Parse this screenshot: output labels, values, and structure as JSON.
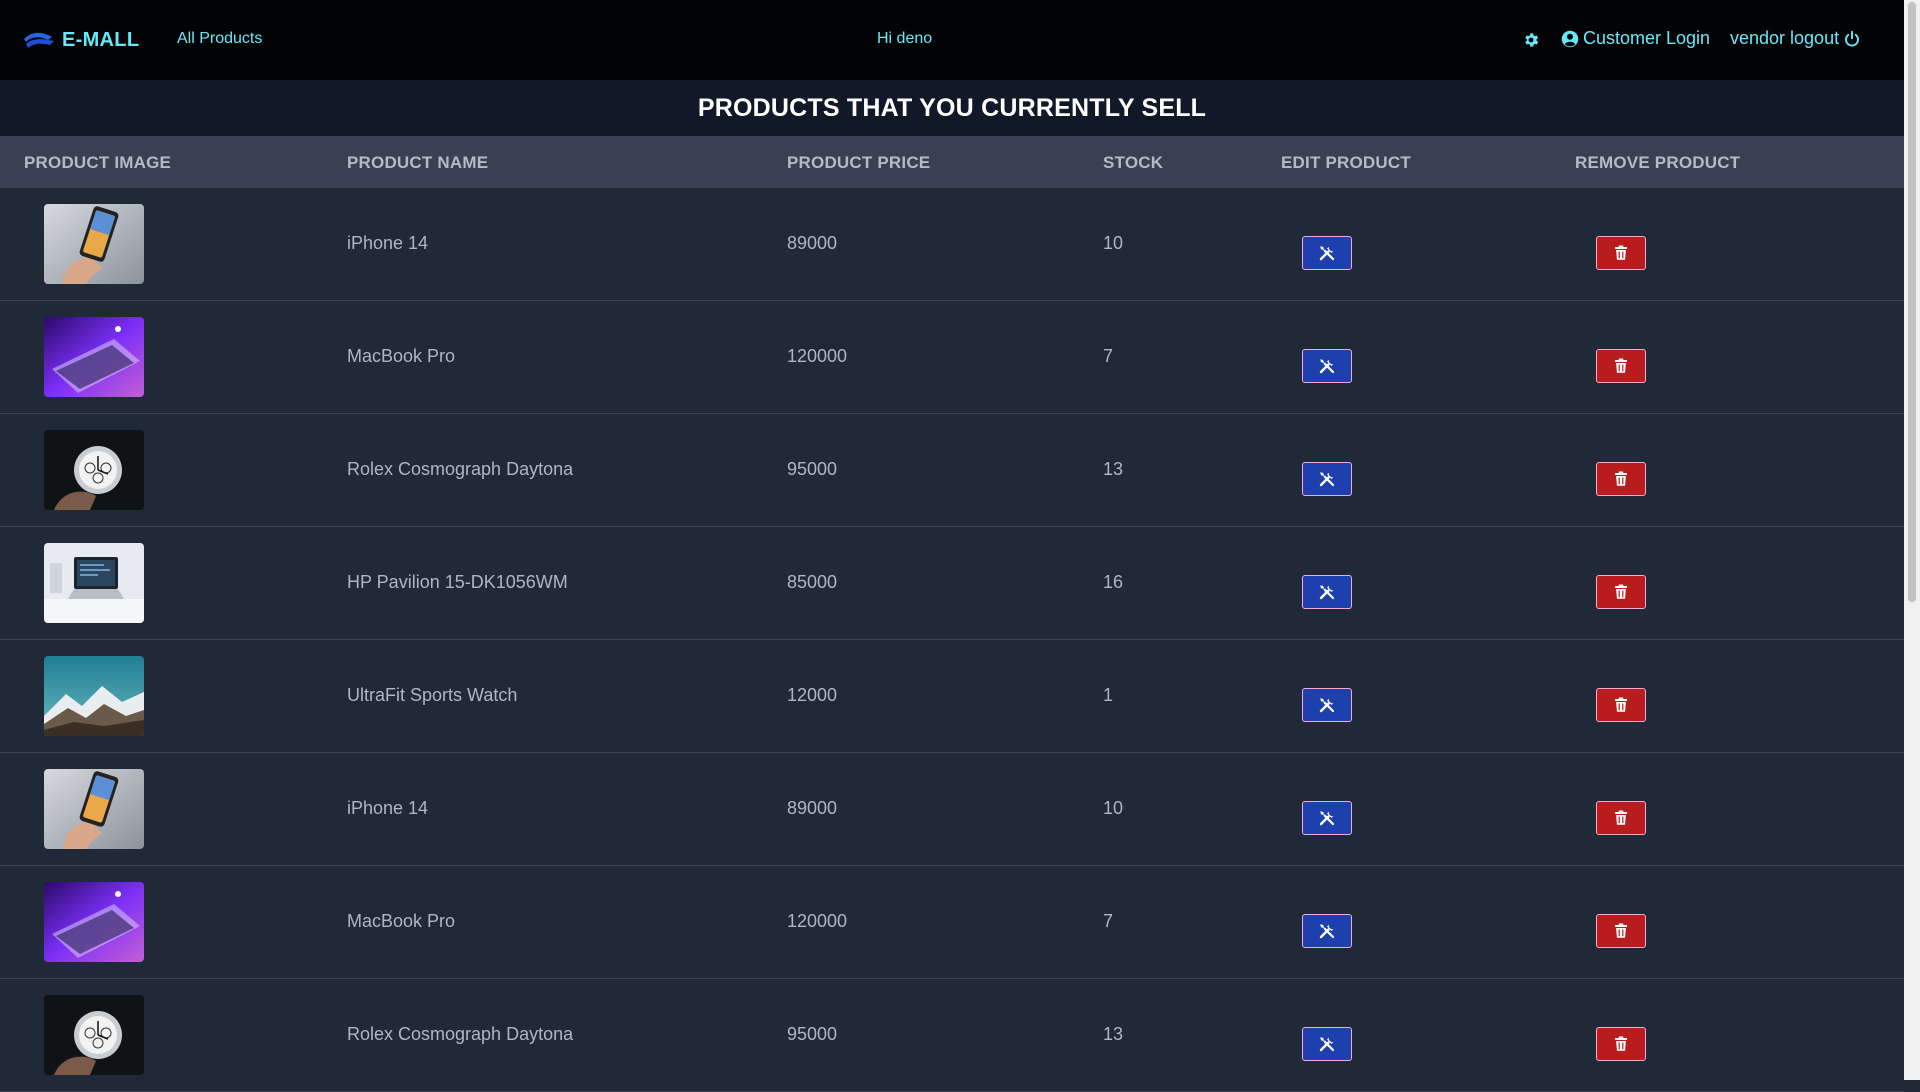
{
  "navbar": {
    "brand": "E-MALL",
    "all_products": "All Products",
    "greeting": "Hi deno",
    "customer_login": "Customer Login",
    "vendor_logout": "vendor logout"
  },
  "page_title": "PRODUCTS THAT YOU CURRENTLY SELL",
  "table": {
    "headers": [
      "PRODUCT IMAGE",
      "PRODUCT NAME",
      "PRODUCT PRICE",
      "STOCK",
      "EDIT PRODUCT",
      "REMOVE PRODUCT"
    ],
    "rows": [
      {
        "name": "iPhone 14",
        "price": "89000",
        "stock": "10",
        "image": "phone"
      },
      {
        "name": "MacBook Pro",
        "price": "120000",
        "stock": "7",
        "image": "laptop-purple"
      },
      {
        "name": "Rolex Cosmograph Daytona",
        "price": "95000",
        "stock": "13",
        "image": "watch"
      },
      {
        "name": "HP Pavilion 15-DK1056WM",
        "price": "85000",
        "stock": "16",
        "image": "desk-laptop"
      },
      {
        "name": "UltraFit Sports Watch",
        "price": "12000",
        "stock": "1",
        "image": "mountain"
      },
      {
        "name": "iPhone 14",
        "price": "89000",
        "stock": "10",
        "image": "phone"
      },
      {
        "name": "MacBook Pro",
        "price": "120000",
        "stock": "7",
        "image": "laptop-purple"
      },
      {
        "name": "Rolex Cosmograph Daytona",
        "price": "95000",
        "stock": "13",
        "image": "watch"
      }
    ]
  },
  "icons": {
    "edit": "tools-icon",
    "remove": "trash-icon",
    "settings": "gear-icon",
    "login": "user-circle-icon",
    "logout": "power-icon"
  },
  "colors": {
    "accent": "#67e8f9",
    "edit_button": "#1e40af",
    "remove_button": "#b91c1c",
    "background": "#1f2937"
  }
}
